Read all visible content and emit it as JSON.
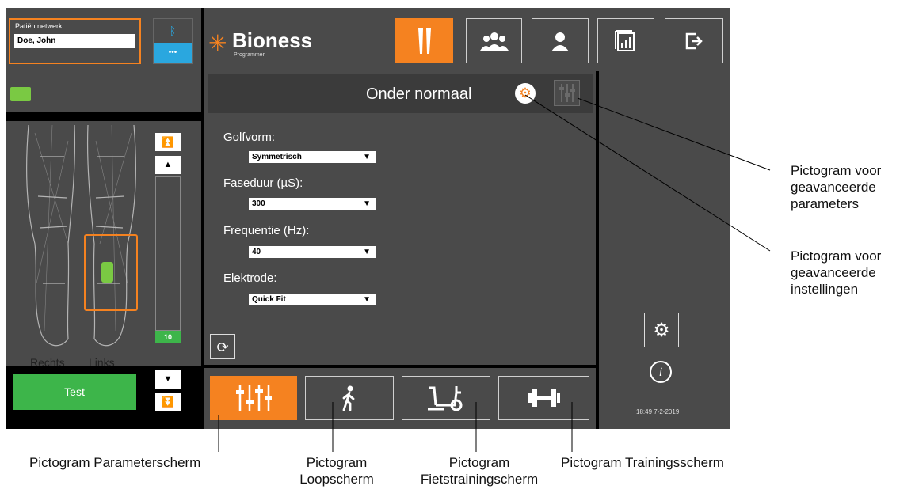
{
  "patient": {
    "network_label": "Patiëntnetwerk",
    "name": "Doe, John"
  },
  "bluetooth": {
    "dots": "•••"
  },
  "brand": {
    "name": "Bioness",
    "sub": "Programmer"
  },
  "legs": {
    "right": "Rechts",
    "left": "Links"
  },
  "intensity": {
    "value": "10"
  },
  "test_button": "Test",
  "header": {
    "title": "Onder normaal"
  },
  "params": [
    {
      "label": "Golfvorm:",
      "value": "Symmetrisch"
    },
    {
      "label": "Faseduur (µS):",
      "value": "300"
    },
    {
      "label": "Frequentie (Hz):",
      "value": "40"
    },
    {
      "label": "Elektrode:",
      "value": "Quick Fit"
    }
  ],
  "timestamp": "18:49 7-2-2019",
  "colors": {
    "accent": "#f58220",
    "green": "#3db54a",
    "panel": "#4a4a4a"
  },
  "callouts": {
    "advanced_params": "Pictogram voor geavanceerde parameters",
    "advanced_settings": "Pictogram voor geavanceerde instellingen",
    "param_screen": "Pictogram Parameterscherm",
    "walk_screen_1": "Pictogram",
    "walk_screen_2": "Loopscherm",
    "bike_screen_1": "Pictogram",
    "bike_screen_2": "Fietstrainingscherm",
    "training_screen": "Pictogram Trainingsscherm"
  }
}
